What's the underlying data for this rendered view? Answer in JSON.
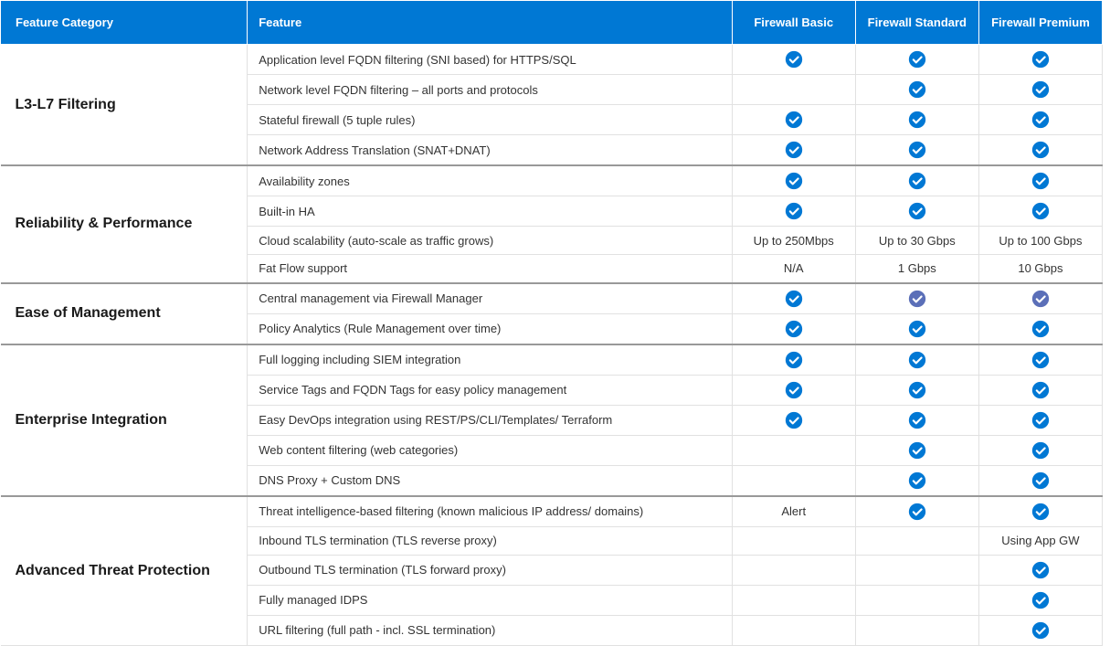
{
  "headers": {
    "category": "Feature Category",
    "feature": "Feature",
    "tiers": [
      "Firewall Basic",
      "Firewall Standard",
      "Firewall Premium"
    ]
  },
  "groups": [
    {
      "name": "L3-L7 Filtering",
      "rows": [
        {
          "feature": "Application level FQDN filtering (SNI based) for HTTPS/SQL",
          "basic": "check",
          "standard": "check",
          "premium": "check"
        },
        {
          "feature": "Network level FQDN filtering – all ports and protocols",
          "basic": "",
          "standard": "check",
          "premium": "check"
        },
        {
          "feature": "Stateful firewall (5 tuple rules)",
          "basic": "check",
          "standard": "check",
          "premium": "check"
        },
        {
          "feature": "Network Address Translation (SNAT+DNAT)",
          "basic": "check",
          "standard": "check",
          "premium": "check"
        }
      ]
    },
    {
      "name": "Reliability & Performance",
      "rows": [
        {
          "feature": "Availability zones",
          "basic": "check",
          "standard": "check",
          "premium": "check"
        },
        {
          "feature": "Built-in  HA",
          "basic": "check",
          "standard": "check",
          "premium": "check"
        },
        {
          "feature": "Cloud scalability (auto-scale as traffic grows)",
          "basic": "Up to 250Mbps",
          "standard": "Up to 30 Gbps",
          "premium": "Up to 100 Gbps"
        },
        {
          "feature": " Fat Flow support",
          "basic": "N/A",
          "standard": "1 Gbps",
          "premium": "10 Gbps"
        }
      ]
    },
    {
      "name": "Ease of Management",
      "rows": [
        {
          "feature": "Central management via Firewall Manager",
          "basic": "check",
          "standard": "check-muted",
          "premium": "check-muted"
        },
        {
          "feature": "Policy Analytics  (Rule Management over time)",
          "basic": "check",
          "standard": "check",
          "premium": "check"
        }
      ]
    },
    {
      "name": "Enterprise Integration",
      "rows": [
        {
          "feature": "Full logging including SIEM integration",
          "basic": "check",
          "standard": "check",
          "premium": "check"
        },
        {
          "feature": "Service Tags and FQDN Tags for easy policy management",
          "basic": "check",
          "standard": "check",
          "premium": "check"
        },
        {
          "feature": "Easy DevOps integration using REST/PS/CLI/Templates/ Terraform",
          "basic": "check",
          "standard": "check",
          "premium": "check"
        },
        {
          "feature": "Web content filtering (web categories)",
          "basic": "",
          "standard": "check",
          "premium": "check"
        },
        {
          "feature": "DNS Proxy + Custom DNS",
          "basic": "",
          "standard": "check",
          "premium": "check"
        }
      ]
    },
    {
      "name": "Advanced Threat Protection",
      "rows": [
        {
          "feature": "Threat intelligence-based filtering (known malicious IP address/ domains)",
          "basic": "Alert",
          "standard": "check",
          "premium": "check"
        },
        {
          "feature": "Inbound TLS termination (TLS reverse proxy)",
          "basic": "",
          "standard": "",
          "premium": "Using App GW"
        },
        {
          "feature": "Outbound TLS termination (TLS forward proxy)",
          "basic": "",
          "standard": "",
          "premium": "check"
        },
        {
          "feature": "Fully managed IDPS",
          "basic": "",
          "standard": "",
          "premium": "check"
        },
        {
          "feature": "URL filtering (full path - incl. SSL termination)",
          "basic": "",
          "standard": "",
          "premium": "check"
        }
      ]
    }
  ]
}
